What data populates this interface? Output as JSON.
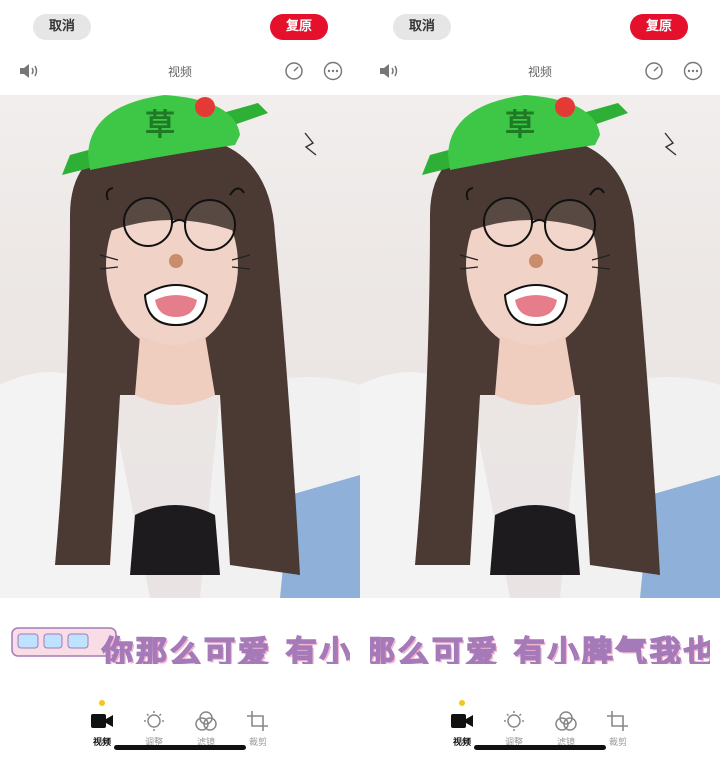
{
  "panels": [
    {
      "cancel_label": "取消",
      "restore_label": "复原",
      "toolbar_title": "视频",
      "caption": "你那么可爱 有小脾气我也惯着你",
      "tabs": [
        {
          "label": "视频",
          "icon": "video-camera-icon",
          "active": true
        },
        {
          "label": "调整",
          "icon": "adjust-brightness-icon",
          "active": false
        },
        {
          "label": "滤镜",
          "icon": "filter-icon",
          "active": false
        },
        {
          "label": "裁剪",
          "icon": "crop-icon",
          "active": false
        }
      ],
      "hat_text": "草"
    },
    {
      "cancel_label": "取消",
      "restore_label": "复原",
      "toolbar_title": "视频",
      "caption": "你那么可爱 有小脾气我也惯着你",
      "tabs": [
        {
          "label": "视频",
          "icon": "video-camera-icon",
          "active": true
        },
        {
          "label": "调整",
          "icon": "adjust-brightness-icon",
          "active": false
        },
        {
          "label": "滤镜",
          "icon": "filter-icon",
          "active": false
        },
        {
          "label": "裁剪",
          "icon": "crop-icon",
          "active": false
        }
      ],
      "hat_text": "草"
    }
  ],
  "colors": {
    "restore_button": "#e5102c",
    "cancel_button": "#e6e6e6",
    "active_dot": "#f5c518",
    "hat_green": "#3ec646"
  }
}
